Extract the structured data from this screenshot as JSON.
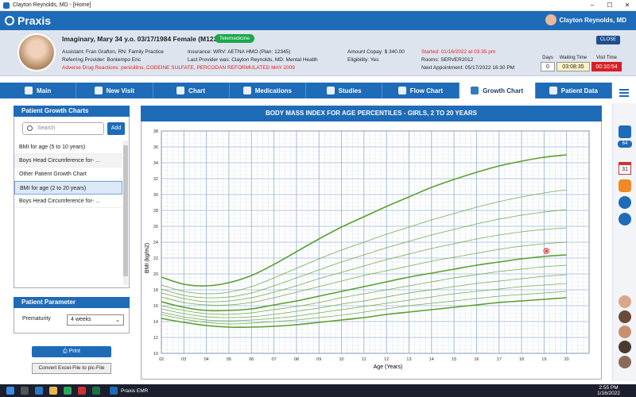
{
  "window": {
    "title": "Clayton Reynolds, MD - [Home]"
  },
  "header": {
    "app_name": "Praxis",
    "user_name": "Clayton Reynolds, MD"
  },
  "patient": {
    "name_line": "Imaginary, Mary 34 y.o. 03/17/1984 Female (M123)",
    "telemedicine_label": "Telemedicine",
    "assistant": "Assistant: Fran Grafton, RN: Family Practice",
    "referring": "Referring Provider: Bontempo Eric",
    "adr_label": "Adverse Drug Reactions:",
    "adr_value": "penicillins, CODEINE SULFATE, PERCODAN REFORMULATED MAY 2009",
    "insurance": "Insurance: WRV: AETNA HMO (Plan: 12345)",
    "last_provider": "Last Provider was: Clayton Reynolds, MD: Mental Health",
    "copay": "Amount Copay: $ 340.00",
    "eligibility": "Eligibility: Yes",
    "started": "Started: 01/16/2022 at 03:35 pm",
    "rooms": "Rooms: SERVER2012",
    "next_appt": "Next Appointment: 05/17/2022 16:30 PM",
    "close_label": "CLOSE",
    "days_label": "Days",
    "days_value": "0",
    "waiting_label": "Waiting Time",
    "waiting_value": "03:08:35",
    "visit_label": "Visit Time",
    "visit_value": "00:10:54"
  },
  "tabs": [
    {
      "label": "Main",
      "icon": "user-icon"
    },
    {
      "label": "New Visit",
      "icon": "new-visit-icon"
    },
    {
      "label": "Chart",
      "icon": "chart-icon"
    },
    {
      "label": "Medications",
      "icon": "medications-icon"
    },
    {
      "label": "Studies",
      "icon": "studies-icon"
    },
    {
      "label": "Flow Chart",
      "icon": "flow-chart-icon"
    },
    {
      "label": "Growth Chart",
      "icon": "growth-chart-icon"
    },
    {
      "label": "Patient Data",
      "icon": "patient-data-icon"
    }
  ],
  "left": {
    "title": "Patient Growth Charts",
    "search_placeholder": "Search",
    "add_label": "Add",
    "items": [
      "BMI for age (5 to 10 years)",
      "Boys Head Circumference for- ...",
      "Other Patient Growth Chart",
      "BMI for age (2 to 20 years)",
      "Boys Head Circumference for- ..."
    ],
    "selected_index": 3
  },
  "param": {
    "title": "Patient Parameter",
    "prematurity_label": "Prematurity",
    "prematurity_value": "4 weeks"
  },
  "buttons": {
    "print": "Print",
    "convert": "Convert Excel-File to pic-File"
  },
  "rightbar": {
    "mail_count": "64",
    "calendar_day": "31"
  },
  "taskbar": {
    "app_label": "Praxis EMR",
    "time": "2:55 PM",
    "date": "1/16/2022"
  },
  "chart_data": {
    "type": "line",
    "title": "BODY MASS INDEX FOR AGE PERCENTILES - GIRLS, 2 TO 20 YEARS",
    "xlabel": "Age (Years)",
    "ylabel": "BMI (kg/m2)",
    "xlim": [
      2,
      21
    ],
    "ylim": [
      10,
      38
    ],
    "xticks": [
      "02",
      "03",
      "04",
      "05",
      "06",
      "07",
      "08",
      "09",
      "10",
      "11",
      "12",
      "13",
      "14",
      "15",
      "16",
      "17",
      "18",
      "19",
      "20"
    ],
    "yticks": [
      10,
      12,
      14,
      16,
      18,
      20,
      22,
      24,
      26,
      28,
      30,
      32,
      34,
      36,
      38
    ],
    "grid": true,
    "x": [
      2,
      3,
      4,
      5,
      6,
      7,
      8,
      9,
      10,
      11,
      12,
      13,
      14,
      15,
      16,
      17,
      18,
      19,
      20
    ],
    "series": [
      {
        "values": [
          19.6,
          18.7,
          18.5,
          18.9,
          19.8,
          21.2,
          22.8,
          24.4,
          25.9,
          27.2,
          28.5,
          29.7,
          30.9,
          31.9,
          32.8,
          33.6,
          34.2,
          34.7,
          35.0
        ],
        "bold": true
      },
      {
        "values": [
          18.6,
          17.8,
          17.5,
          17.7,
          18.4,
          19.5,
          20.7,
          21.9,
          23.0,
          24.0,
          25.0,
          25.9,
          26.8,
          27.6,
          28.4,
          29.1,
          29.7,
          30.2,
          30.6
        ],
        "bold": false
      },
      {
        "values": [
          18.1,
          17.3,
          17.0,
          17.1,
          17.6,
          18.5,
          19.5,
          20.5,
          21.5,
          22.4,
          23.3,
          24.1,
          24.9,
          25.6,
          26.3,
          26.9,
          27.4,
          27.8,
          28.1
        ],
        "bold": false
      },
      {
        "values": [
          17.6,
          16.9,
          16.5,
          16.6,
          17.0,
          17.7,
          18.5,
          19.4,
          20.2,
          21.0,
          21.8,
          22.5,
          23.2,
          23.8,
          24.4,
          24.9,
          25.3,
          25.6,
          25.8
        ],
        "bold": false
      },
      {
        "values": [
          17.1,
          16.4,
          16.1,
          16.1,
          16.4,
          17.0,
          17.7,
          18.4,
          19.1,
          19.8,
          20.4,
          21.0,
          21.6,
          22.1,
          22.6,
          23.1,
          23.5,
          23.8,
          24.0
        ],
        "bold": false
      },
      {
        "values": [
          16.5,
          15.8,
          15.4,
          15.4,
          15.6,
          16.1,
          16.6,
          17.2,
          17.8,
          18.4,
          19.0,
          19.6,
          20.1,
          20.6,
          21.1,
          21.5,
          21.9,
          22.2,
          22.4
        ],
        "bold": true
      },
      {
        "values": [
          16.0,
          15.4,
          15.0,
          14.9,
          15.1,
          15.5,
          15.9,
          16.4,
          17.0,
          17.5,
          18.0,
          18.5,
          19.0,
          19.5,
          19.9,
          20.3,
          20.6,
          20.9,
          21.1
        ],
        "bold": false
      },
      {
        "values": [
          15.6,
          15.0,
          14.6,
          14.5,
          14.6,
          14.9,
          15.3,
          15.7,
          16.2,
          16.6,
          17.1,
          17.6,
          18.0,
          18.4,
          18.8,
          19.1,
          19.4,
          19.7,
          19.9
        ],
        "bold": false
      },
      {
        "values": [
          15.2,
          14.6,
          14.2,
          14.1,
          14.2,
          14.4,
          14.7,
          15.1,
          15.5,
          15.9,
          16.3,
          16.7,
          17.1,
          17.5,
          17.8,
          18.1,
          18.4,
          18.6,
          18.8
        ],
        "bold": false
      },
      {
        "values": [
          14.9,
          14.3,
          13.9,
          13.7,
          13.8,
          14.0,
          14.2,
          14.5,
          14.8,
          15.2,
          15.6,
          16.0,
          16.3,
          16.6,
          16.9,
          17.2,
          17.4,
          17.6,
          17.8
        ],
        "bold": false
      },
      {
        "values": [
          14.4,
          13.9,
          13.5,
          13.3,
          13.3,
          13.4,
          13.6,
          13.9,
          14.2,
          14.5,
          14.9,
          15.2,
          15.5,
          15.8,
          16.1,
          16.4,
          16.6,
          16.8,
          17.0
        ],
        "bold": true
      }
    ],
    "patient_point": {
      "x": 19.1,
      "y": 22.9
    },
    "colors": {
      "line": "#5aa02c",
      "grid": "#9bb6d8",
      "point": "#d22222"
    }
  }
}
